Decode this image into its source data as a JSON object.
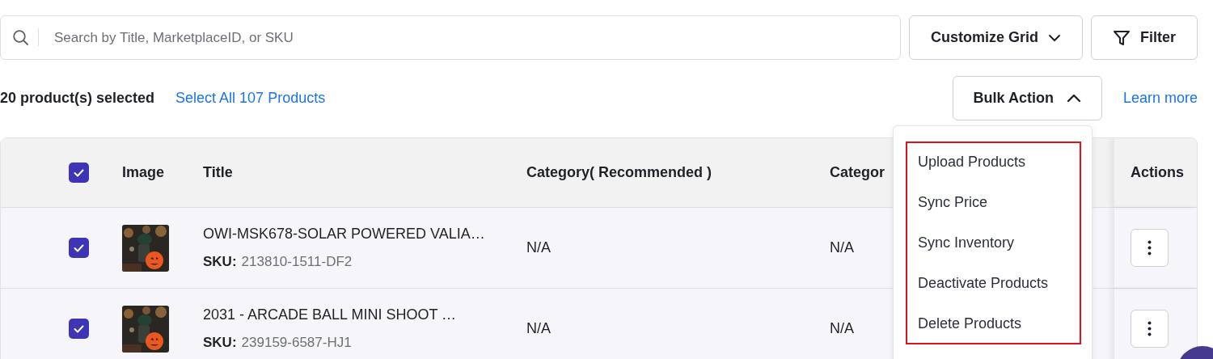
{
  "search": {
    "placeholder": "Search by Title, MarketplaceID, or SKU"
  },
  "toolbar_buttons": [
    {
      "kind": "dropdown",
      "label": "Customize Grid"
    },
    {
      "kind": "filter",
      "label": "Filter"
    }
  ],
  "selection": {
    "count_text": "20 product(s) selected",
    "select_all_link": "Select All 107 Products"
  },
  "bulk_action": {
    "label": "Bulk Action",
    "expanded": true,
    "menu_items": [
      "Upload Products",
      "Sync Price",
      "Sync Inventory",
      "Deactivate Products",
      "Delete Products"
    ]
  },
  "learn_more_link": "Learn more",
  "table": {
    "select_all_checked": true,
    "columns": [
      "Image",
      "Title",
      "Category( Recommended )",
      "Categor",
      "Actions"
    ],
    "rows": [
      {
        "checked": true,
        "title": "OWI-MSK678-SOLAR POWERED VALIA…",
        "sku_label": "SKU:",
        "sku": "213810-1511-DF2",
        "category_recommended": "N/A",
        "category": "N/A"
      },
      {
        "checked": true,
        "title": "2031 - ARCADE BALL MINI SHOOT …",
        "sku_label": "SKU:",
        "sku": "239159-6587-HJ1",
        "category_recommended": "N/A",
        "category": "N/A"
      }
    ]
  }
}
